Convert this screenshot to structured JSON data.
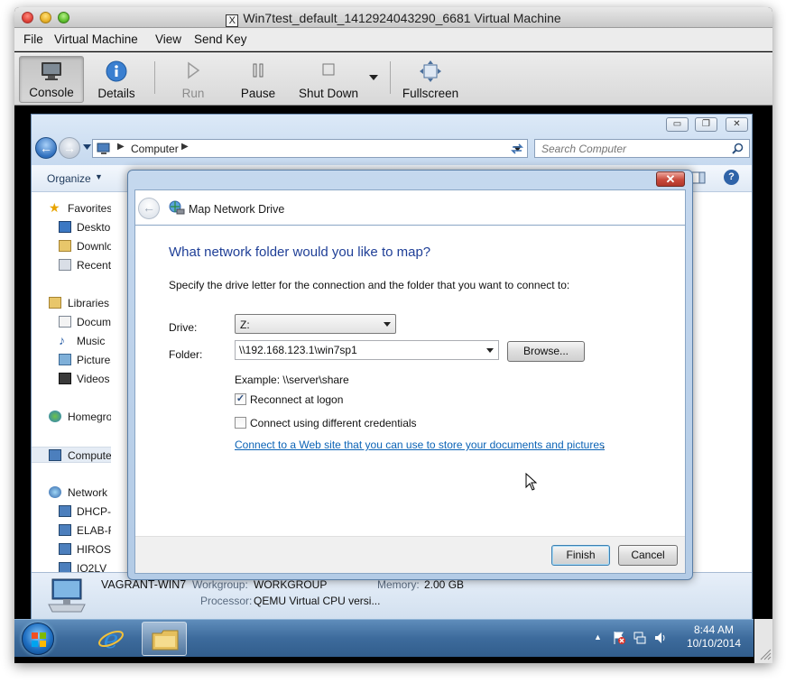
{
  "host": {
    "title": "Win7test_default_1412924043290_6681 Virtual Machine",
    "menu": [
      "File",
      "Virtual Machine",
      "View",
      "Send Key"
    ],
    "toolbar": {
      "console": "Console",
      "details": "Details",
      "run": "Run",
      "pause": "Pause",
      "shutdown": "Shut Down",
      "fullscreen": "Fullscreen"
    }
  },
  "explorer": {
    "address": "Computer",
    "search_placeholder": "Search Computer",
    "organize": "Organize",
    "nav": {
      "favorites": "Favorites",
      "desktop": "Desktop",
      "downloads": "Downloads",
      "recent": "Recent Places",
      "libraries": "Libraries",
      "documents": "Documents",
      "music": "Music",
      "pictures": "Pictures",
      "videos": "Videos",
      "homegroup": "Homegroup",
      "computer": "Computer",
      "network": "Network",
      "net_items": [
        "DHCP-",
        "ELAB-R",
        "HIROS",
        "IQ2LV"
      ]
    },
    "details": {
      "name": "VAGRANT-WIN7",
      "workgroup_label": "Workgroup:",
      "workgroup": "WORKGROUP",
      "memory_label": "Memory:",
      "memory": "2.00 GB",
      "processor_label": "Processor:",
      "processor": "QEMU Virtual CPU versi..."
    }
  },
  "dialog": {
    "title": "Map Network Drive",
    "heading": "What network folder would you like to map?",
    "description": "Specify the drive letter for the connection and the folder that you want to connect to:",
    "drive_label": "Drive:",
    "drive_value": "Z:",
    "folder_label": "Folder:",
    "folder_value": "\\\\192.168.123.1\\win7sp1",
    "browse": "Browse...",
    "example": "Example: \\\\server\\share",
    "reconnect": "Reconnect at logon",
    "reconnect_checked": true,
    "credentials": "Connect using different credentials",
    "credentials_checked": false,
    "link": "Connect to a Web site that you can use to store your documents and pictures",
    "link_suffix": ".",
    "finish": "Finish",
    "cancel": "Cancel"
  },
  "taskbar": {
    "time": "8:44 AM",
    "date": "10/10/2014"
  },
  "colors": {
    "heading": "#1f3f97",
    "link": "#0b63b6",
    "taskbar": "#3d6b9c"
  }
}
